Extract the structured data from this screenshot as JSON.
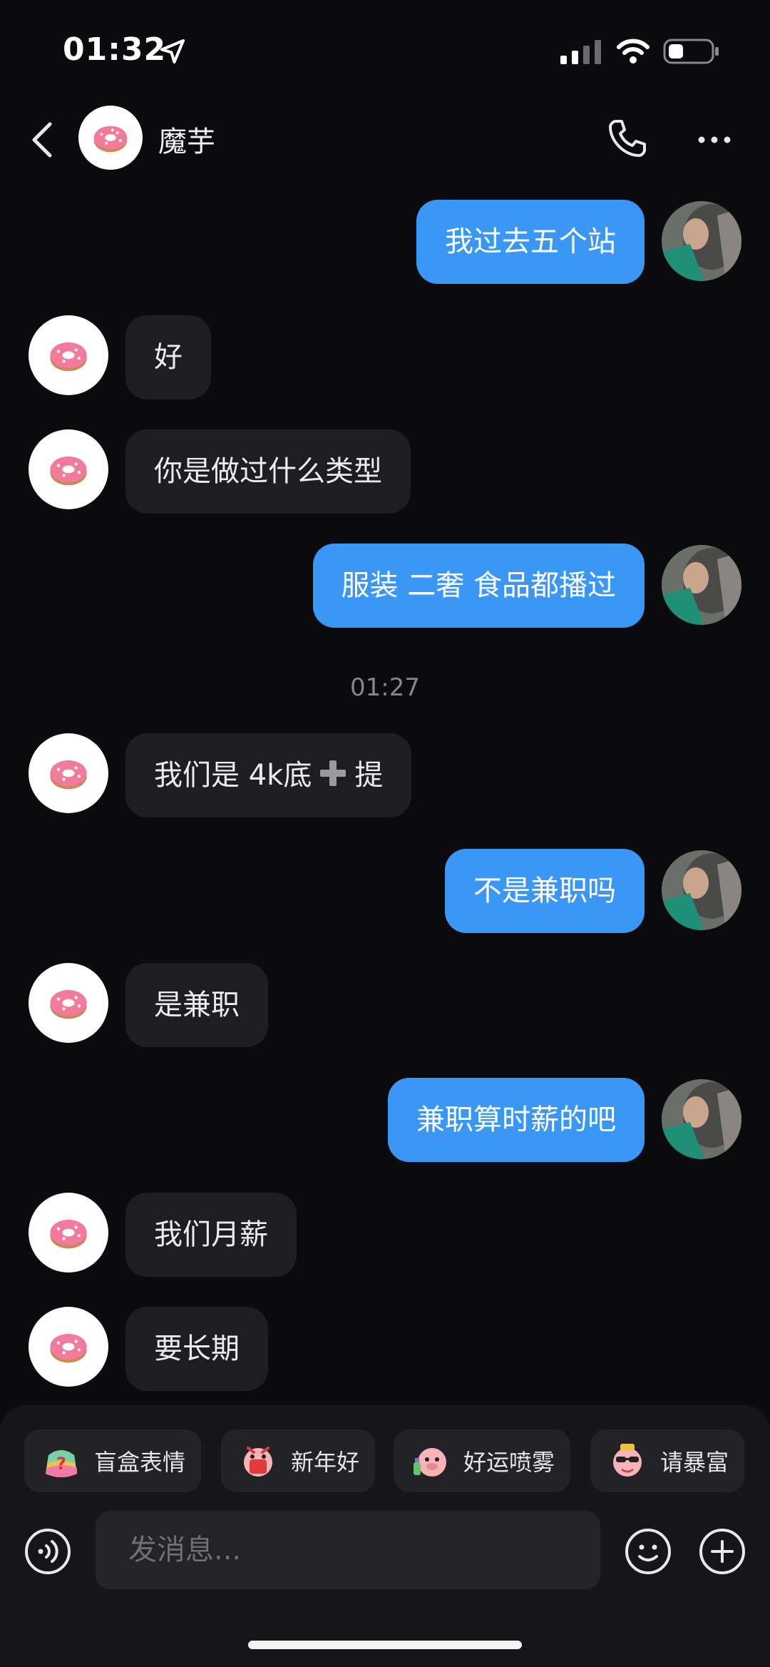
{
  "status_bar": {
    "time": "01:32"
  },
  "header": {
    "contact_name": "魔芋"
  },
  "messages": [
    {
      "side": "out",
      "text": "我过去五个站"
    },
    {
      "side": "in",
      "text": "好"
    },
    {
      "side": "in",
      "text": "你是做过什么类型"
    },
    {
      "side": "out",
      "text": "服装 二奢 食品都播过"
    },
    {
      "side": "in",
      "text_before": "我们是 4k底",
      "text_after": "提"
    },
    {
      "side": "out",
      "text": "不是兼职吗"
    },
    {
      "side": "in",
      "text": "是兼职"
    },
    {
      "side": "out",
      "text": "兼职算时薪的吧"
    },
    {
      "side": "in",
      "text": "我们月薪"
    },
    {
      "side": "in",
      "text": "要长期"
    }
  ],
  "timestamp": "01:27",
  "stickers": [
    {
      "label": "盲盒表情",
      "icon": "question-bag-icon"
    },
    {
      "label": "新年好",
      "icon": "new-year-pig-icon"
    },
    {
      "label": "好运喷雾",
      "icon": "lucky-spray-pig-icon"
    },
    {
      "label": "请暴富",
      "icon": "sunglasses-pig-icon"
    }
  ],
  "input": {
    "placeholder": "发消息..."
  },
  "colors": {
    "outgoing_bubble": "#3b97f5",
    "incoming_bubble": "#1e1e22",
    "background": "#0b0b0d"
  }
}
